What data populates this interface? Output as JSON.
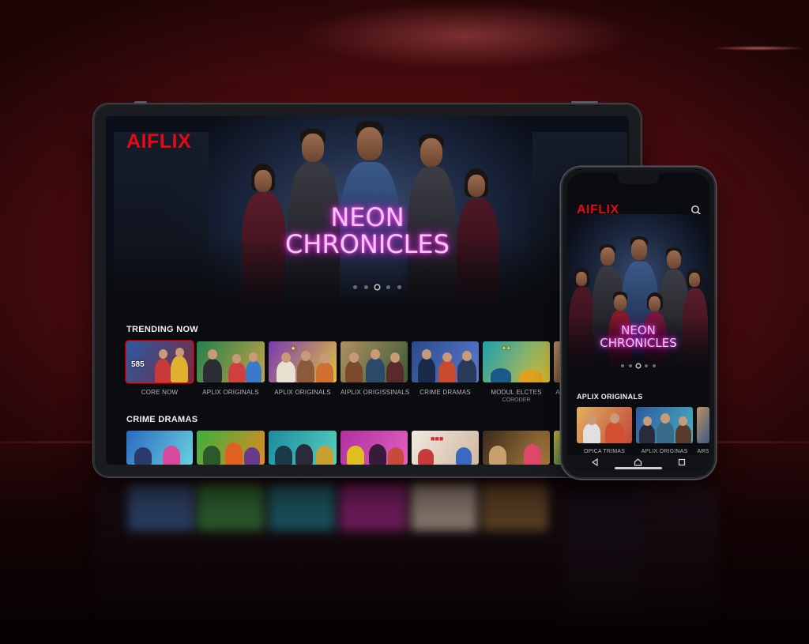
{
  "brand": "AIFLIX",
  "colors": {
    "brand_red": "#e50914",
    "neon_title": "#e879f9",
    "background": "#5a0d10"
  },
  "tablet": {
    "hero": {
      "title_line1": "NEON",
      "title_line2": "CHRONICLES",
      "carousel_pages": 5,
      "carousel_active": 3
    },
    "rows": [
      {
        "title": "TRENDING NOW",
        "items": [
          {
            "caption": "CORE NOW",
            "badge": "585"
          },
          {
            "caption": "APLIX ORIGINALS"
          },
          {
            "caption": "APLIX ORIGINALS"
          },
          {
            "caption": "AIPLIX ORIGISSINALS"
          },
          {
            "caption": "CRIME DRAMAS"
          },
          {
            "caption": "MODUL ELCTES",
            "subcaption": "CORODER"
          },
          {
            "caption": "AC"
          }
        ]
      },
      {
        "title": "CRIME DRAMAS",
        "items": [
          {},
          {},
          {},
          {},
          {},
          {},
          {}
        ]
      }
    ]
  },
  "phone": {
    "icons": {
      "search": "search-icon",
      "back": "back-icon",
      "home": "home-icon",
      "recents": "recents-icon"
    },
    "hero": {
      "title_line1": "NEON",
      "title_line2": "CHRONICLES",
      "carousel_pages": 5,
      "carousel_active": 3
    },
    "row": {
      "title": "APLIX ORIGINALS",
      "items": [
        {
          "caption": "OPICA TRIMAS"
        },
        {
          "caption": "APLIX ORIGINAS"
        },
        {
          "caption": "ARS"
        }
      ]
    }
  }
}
